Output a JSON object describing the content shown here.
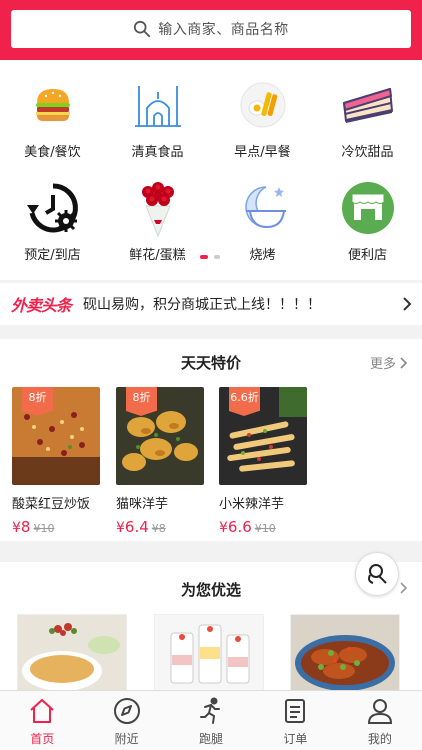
{
  "search": {
    "placeholder": "输入商家、商品名称",
    "icon": "search-icon"
  },
  "categories": [
    {
      "label": "美食/餐饮",
      "icon": "burger-icon"
    },
    {
      "label": "清真食品",
      "icon": "mosque-icon"
    },
    {
      "label": "早点/早餐",
      "icon": "breakfast-plate-icon"
    },
    {
      "label": "冷饮甜品",
      "icon": "cake-icon"
    },
    {
      "label": "预定/到店",
      "icon": "clock-gear-icon"
    },
    {
      "label": "鲜花/蛋糕",
      "icon": "flower-bouquet-icon"
    },
    {
      "label": "烧烤",
      "icon": "moon-bowl-icon"
    },
    {
      "label": "便利店",
      "icon": "store-icon"
    }
  ],
  "headline": {
    "logo": "外卖头条",
    "text": "砚山易购，积分商城正式上线！！！！"
  },
  "specials": {
    "title": "天天特价",
    "more": "更多",
    "items": [
      {
        "discount": "8折",
        "name": "酸菜红豆炒饭",
        "currency": "¥",
        "price": "8",
        "old_price": "¥10"
      },
      {
        "discount": "8折",
        "name": "猫咪洋芋",
        "currency": "¥",
        "price": "6.4",
        "old_price": "¥8"
      },
      {
        "discount": "6.6折",
        "name": "小米辣洋芋",
        "currency": "¥",
        "price": "6.6",
        "old_price": "¥10"
      }
    ]
  },
  "recommend": {
    "title": "为您优选"
  },
  "tabs": [
    {
      "label": "首页",
      "icon": "home-icon",
      "active": true
    },
    {
      "label": "附近",
      "icon": "compass-icon",
      "active": false
    },
    {
      "label": "跑腿",
      "icon": "runner-icon",
      "active": false
    },
    {
      "label": "订单",
      "icon": "order-list-icon",
      "active": false
    },
    {
      "label": "我的",
      "icon": "user-icon",
      "active": false
    }
  ],
  "colors": {
    "brand": "#f0214a",
    "discount_badge": "#f26b4a"
  }
}
